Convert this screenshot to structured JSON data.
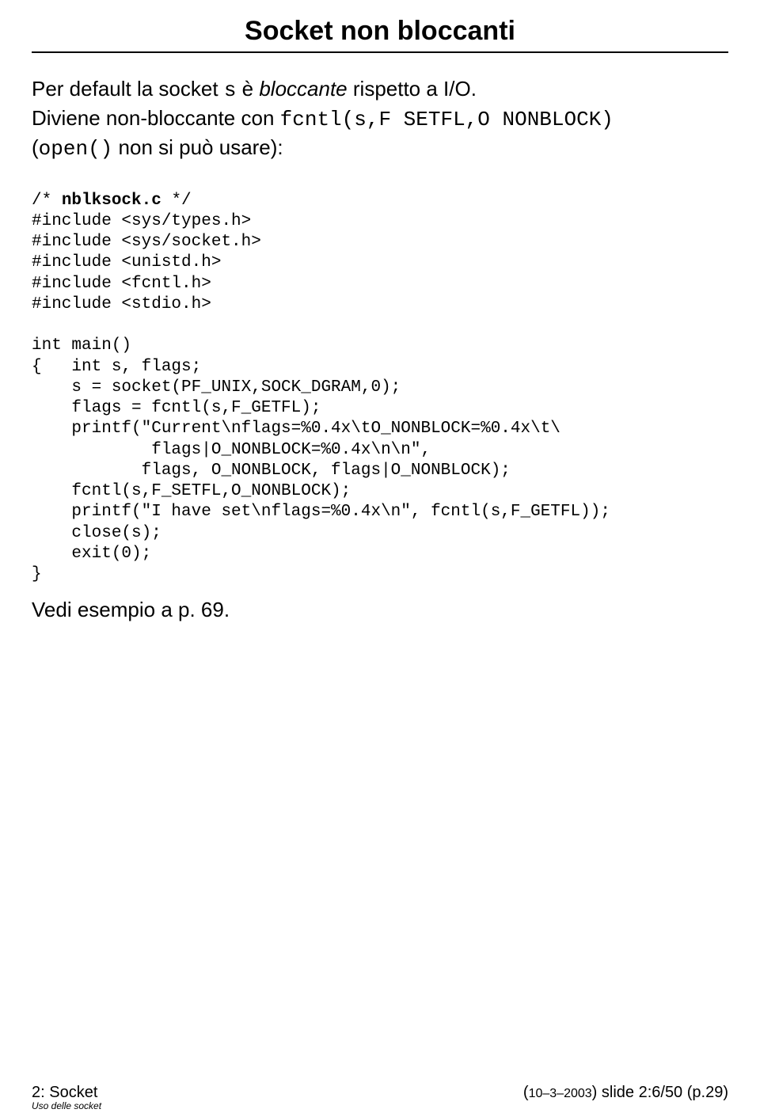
{
  "title": "Socket non bloccanti",
  "line1_a": "Per default la socket ",
  "line1_b": "s",
  "line1_c": " è ",
  "line1_d": "bloccante",
  "line1_e": " rispetto a I/O.",
  "line2_a": "Diviene non-bloccante con ",
  "line2_b": "fcntl(s,F SETFL,O NONBLOCK)",
  "line3_a": "(",
  "line3_b": "open()",
  "line3_c": " non si può usare):",
  "c1": "/* ",
  "c1b": "nblksock.c",
  "c1c": " */",
  "c2": "#include <sys/types.h>",
  "c3": "#include <sys/socket.h>",
  "c4": "#include <unistd.h>",
  "c5": "#include <fcntl.h>",
  "c6": "#include <stdio.h>",
  "c7": "int main()",
  "c8": "{   int s, flags;",
  "c9": "    s = socket(PF_UNIX,SOCK_DGRAM,0);",
  "c10": "    flags = fcntl(s,F_GETFL);",
  "c11": "    printf(\"Current\\nflags=%0.4x\\tO_NONBLOCK=%0.4x\\t\\",
  "c12": "            flags|O_NONBLOCK=%0.4x\\n\\n\",",
  "c13": "           flags, O_NONBLOCK, flags|O_NONBLOCK);",
  "c14": "    fcntl(s,F_SETFL,O_NONBLOCK);",
  "c15": "    printf(\"I have set\\nflags=%0.4x\\n\", fcntl(s,F_GETFL));",
  "c16": "    close(s);",
  "c17": "    exit(0);",
  "c18": "}",
  "after": "Vedi esempio a p. 69.",
  "footer_left": "2: Socket",
  "footer_right_a": "(",
  "footer_right_date": "10–3–2003",
  "footer_right_b": ") slide 2:6/50 (p.29)",
  "uso": "Uso delle socket"
}
